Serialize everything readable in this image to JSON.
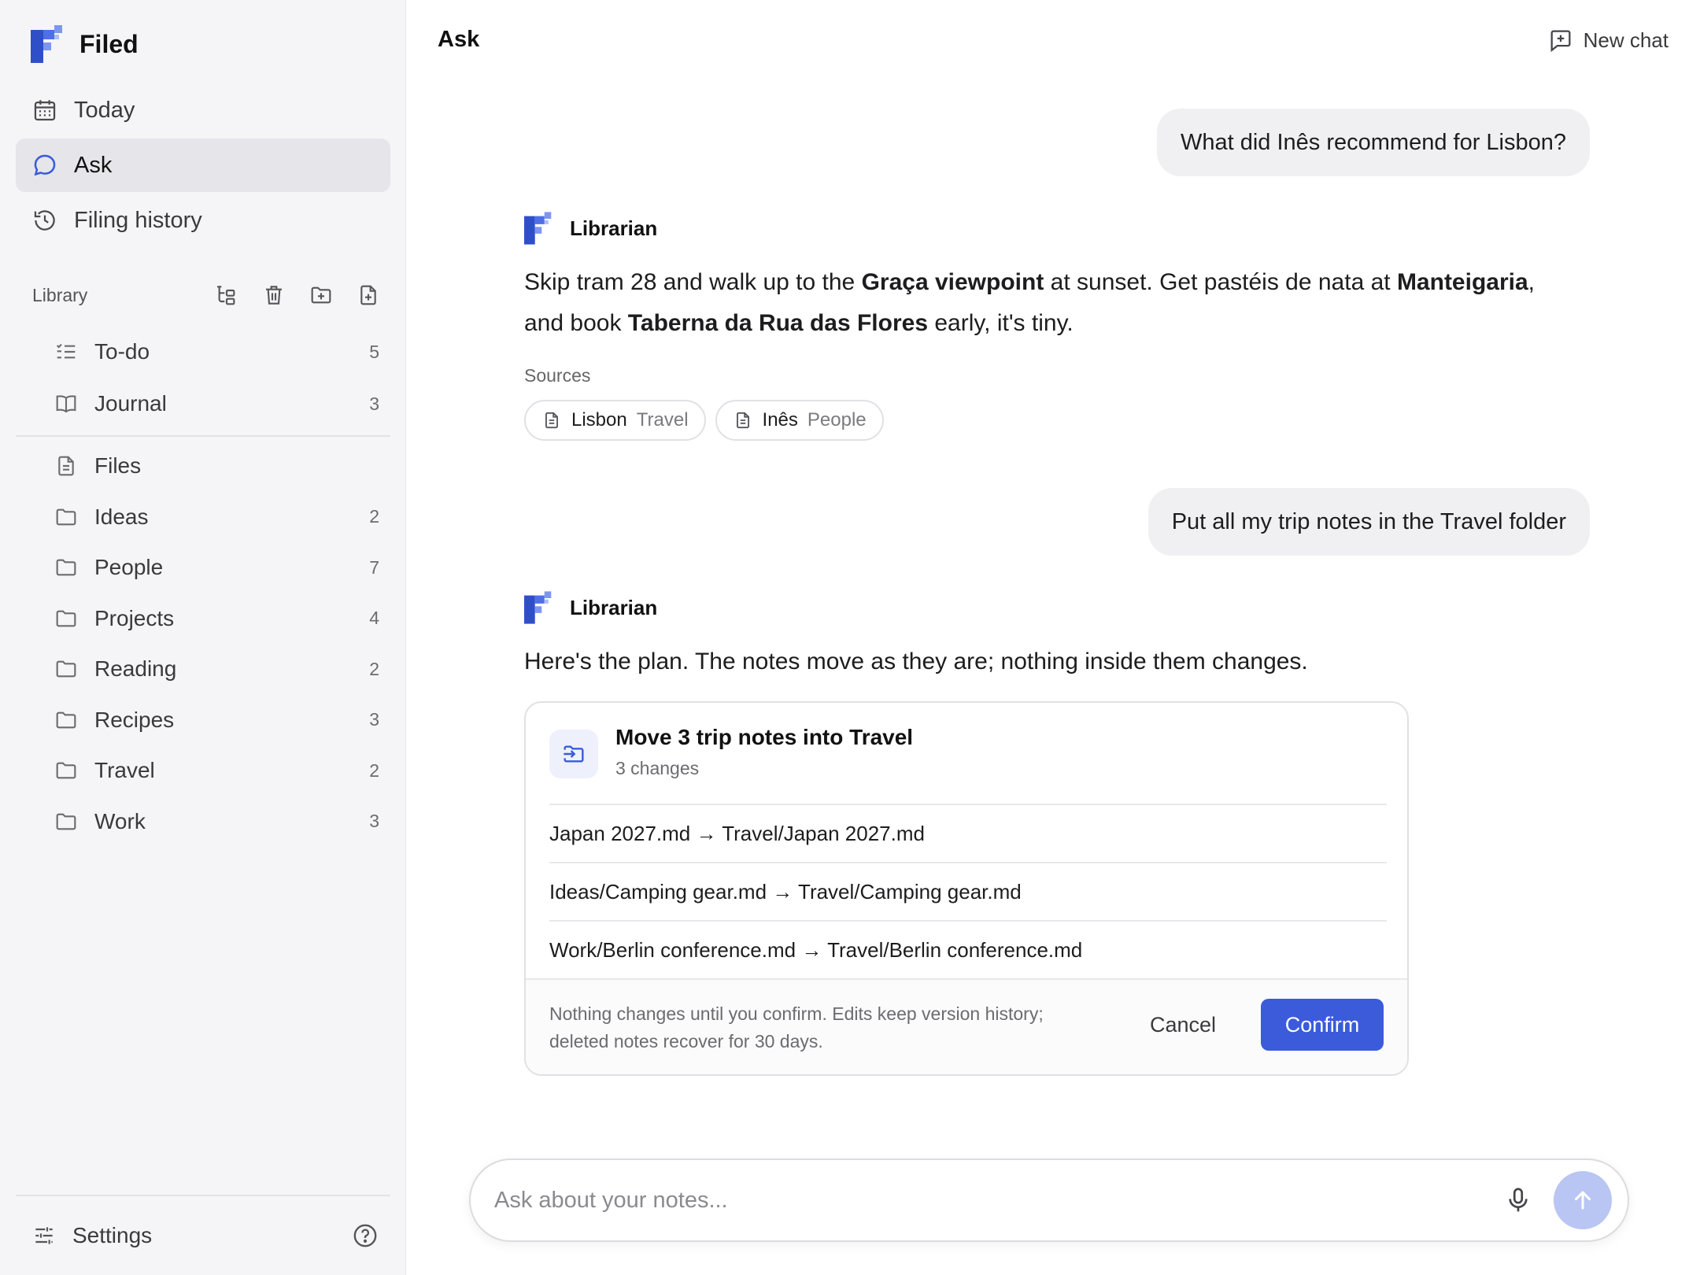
{
  "app": {
    "name": "Filed"
  },
  "nav": {
    "today": "Today",
    "ask": "Ask",
    "filing_history": "Filing history"
  },
  "library": {
    "title": "Library",
    "top_items": [
      {
        "label": "To-do",
        "count": "5"
      },
      {
        "label": "Journal",
        "count": "3"
      }
    ],
    "files_label": "Files",
    "folders": [
      {
        "label": "Ideas",
        "count": "2"
      },
      {
        "label": "People",
        "count": "7"
      },
      {
        "label": "Projects",
        "count": "4"
      },
      {
        "label": "Reading",
        "count": "2"
      },
      {
        "label": "Recipes",
        "count": "3"
      },
      {
        "label": "Travel",
        "count": "2"
      },
      {
        "label": "Work",
        "count": "3"
      }
    ]
  },
  "settings": {
    "label": "Settings"
  },
  "header": {
    "title": "Ask",
    "new_chat": "New chat"
  },
  "chat": {
    "user_msg_1": "What did Inês recommend for Lisbon?",
    "bot_name": "Librarian",
    "reply_1": {
      "t1": "Skip tram 28 and walk up to the ",
      "b1": "Graça viewpoint",
      "t2": " at sunset. Get pastéis de nata at ",
      "b2": "Manteigaria",
      "t3": ",",
      "t4": "and book ",
      "b3": "Taberna da Rua das Flores",
      "t5": " early, it's tiny."
    },
    "sources_label": "Sources",
    "sources": [
      {
        "name": "Lisbon",
        "tag": "Travel"
      },
      {
        "name": "Inês",
        "tag": "People"
      }
    ],
    "user_msg_2": "Put all my trip notes in the Travel folder",
    "reply_2": "Here's the plan. The notes move as they are; nothing inside them changes.",
    "plan": {
      "title": "Move 3 trip notes into Travel",
      "subtitle": "3 changes",
      "changes": [
        "Japan 2027.md → Travel/Japan 2027.md",
        "Ideas/Camping gear.md → Travel/Camping gear.md",
        "Work/Berlin conference.md → Travel/Berlin conference.md"
      ],
      "note_line_1": "Nothing changes until you confirm. Edits keep version history;",
      "note_line_2": "deleted notes recover for 30 days.",
      "cancel": "Cancel",
      "confirm": "Confirm"
    }
  },
  "composer": {
    "placeholder": "Ask about your notes..."
  },
  "colors": {
    "accent": "#3b5bdb",
    "send_disabled": "#b9c5f3",
    "sidebar_bg": "#f5f5f7"
  },
  "icons": {
    "today": "calendar-icon",
    "ask": "chat-bubble-icon",
    "history": "history-icon",
    "todo": "checklist-icon",
    "journal": "book-icon",
    "files": "file-icon",
    "folder": "folder-icon",
    "settings": "sliders-icon",
    "help": "help-icon",
    "new_chat": "new-chat-icon",
    "source": "document-icon",
    "plan": "move-folder-icon",
    "mic": "microphone-icon",
    "send": "arrow-up-icon"
  }
}
